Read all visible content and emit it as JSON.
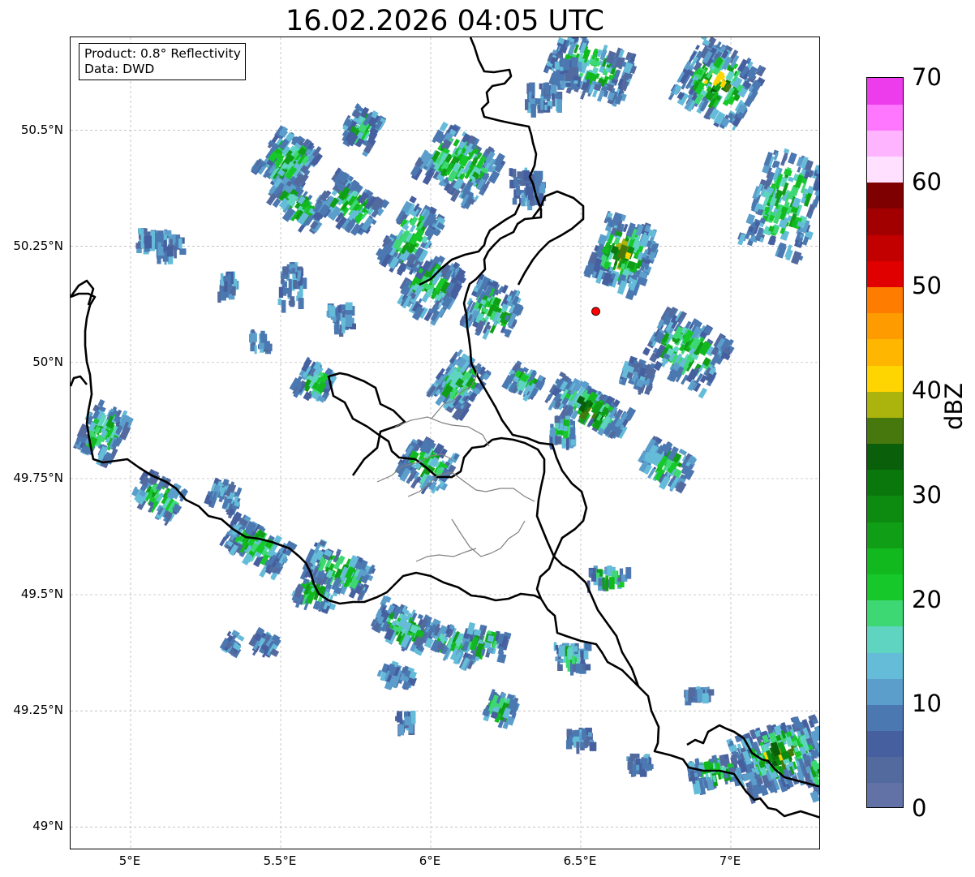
{
  "title": "16.02.2026 04:05 UTC",
  "info": {
    "product": "Product: 0.8° Reflectivity",
    "source": "Data: DWD"
  },
  "map": {
    "lon_range": [
      4.8,
      7.3
    ],
    "lat_range": [
      48.95,
      50.7
    ],
    "gridlines": true,
    "y_ticks": [
      {
        "value": 50.5,
        "label": "50.5°N"
      },
      {
        "value": 50.25,
        "label": "50.25°N"
      },
      {
        "value": 50.0,
        "label": "50°N"
      },
      {
        "value": 49.75,
        "label": "49.75°N"
      },
      {
        "value": 49.5,
        "label": "49.5°N"
      },
      {
        "value": 49.25,
        "label": "49.25°N"
      },
      {
        "value": 49.0,
        "label": "49°N"
      }
    ],
    "x_ticks": [
      {
        "value": 5.0,
        "label": "5°E"
      },
      {
        "value": 5.5,
        "label": "5.5°E"
      },
      {
        "value": 6.0,
        "label": "6°E"
      },
      {
        "value": 6.5,
        "label": "6.5°E"
      },
      {
        "value": 7.0,
        "label": "7°E"
      }
    ],
    "radar_site": {
      "lon": 6.55,
      "lat": 50.11,
      "color": "#ff0000"
    }
  },
  "colorbar": {
    "unit": "dBZ",
    "min": 0,
    "max": 70,
    "ticks": [
      "0",
      "10",
      "20",
      "30",
      "40",
      "50",
      "60",
      "70"
    ],
    "colors": [
      "#6272a6",
      "#536a9f",
      "#455f9f",
      "#4b78b0",
      "#5b9ecb",
      "#65bcd9",
      "#5fd4c1",
      "#3dd873",
      "#16c82a",
      "#12b91e",
      "#119e17",
      "#0d8a10",
      "#0a770d",
      "#095f0a",
      "#47780e",
      "#aab40c",
      "#fed500",
      "#feb600",
      "#fe9b00",
      "#fe7c00",
      "#e00000",
      "#c30000",
      "#a20000",
      "#7e0000",
      "#ffe1ff",
      "#ffb4ff",
      "#ff76ff",
      "#ec3cec"
    ]
  }
}
